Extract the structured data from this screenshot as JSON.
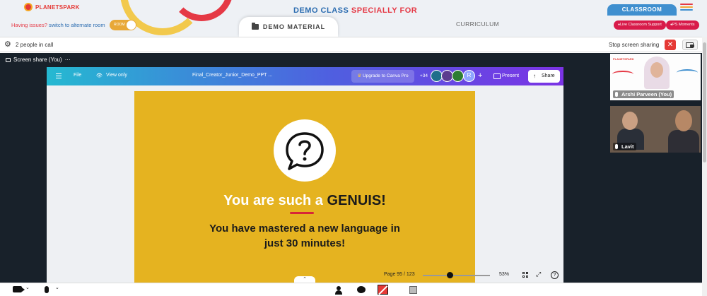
{
  "header": {
    "logo_text": "PLANETSPARK",
    "demo_title_part1": "DEMO CLASS",
    "demo_title_part2": "SPECIALLY FOR",
    "issues_text": "Having issues?",
    "alternate_room_link": "switch to alternate room",
    "room_toggle_label": "ROOM",
    "demo_material_tab": "DEMO MATERIAL",
    "curriculum_tab": "CURRICULUM",
    "classroom_tab": "CLASSROOM",
    "live_support_button": "Live Classroom Support",
    "ps_moments_button": "PS Moments",
    "colors": {
      "accent_blue": "#3f8fcf",
      "accent_red": "#d81b4a",
      "toggle_orange": "#e8a838"
    }
  },
  "callbar": {
    "people_count": "2 people in call",
    "stop_sharing_label": "Stop screen sharing"
  },
  "stage": {
    "share_label": "Screen share (You)",
    "more_glyph": "···"
  },
  "canva": {
    "file_menu": "File",
    "view_mode": "View only",
    "doc_title": "Final_Creator_Junior_Demo_PPT ...",
    "upgrade_button": "Upgrade to Canva Pro",
    "collaborator_count": "+34",
    "avatar_initial": "R",
    "present_button": "Present",
    "share_button": "Share",
    "page_indicator": "Page 95 / 123",
    "zoom_level": "53%",
    "zoom_fraction": 0.4
  },
  "slide": {
    "title_part1": "You are such a",
    "title_part2": "GENUIS!",
    "subtitle": "You have mastered a new language in just 30 minutes!",
    "background_color": "#e5b320"
  },
  "participants": [
    {
      "name": "Arshi Parveen (You)"
    },
    {
      "name": "Lavit"
    }
  ]
}
